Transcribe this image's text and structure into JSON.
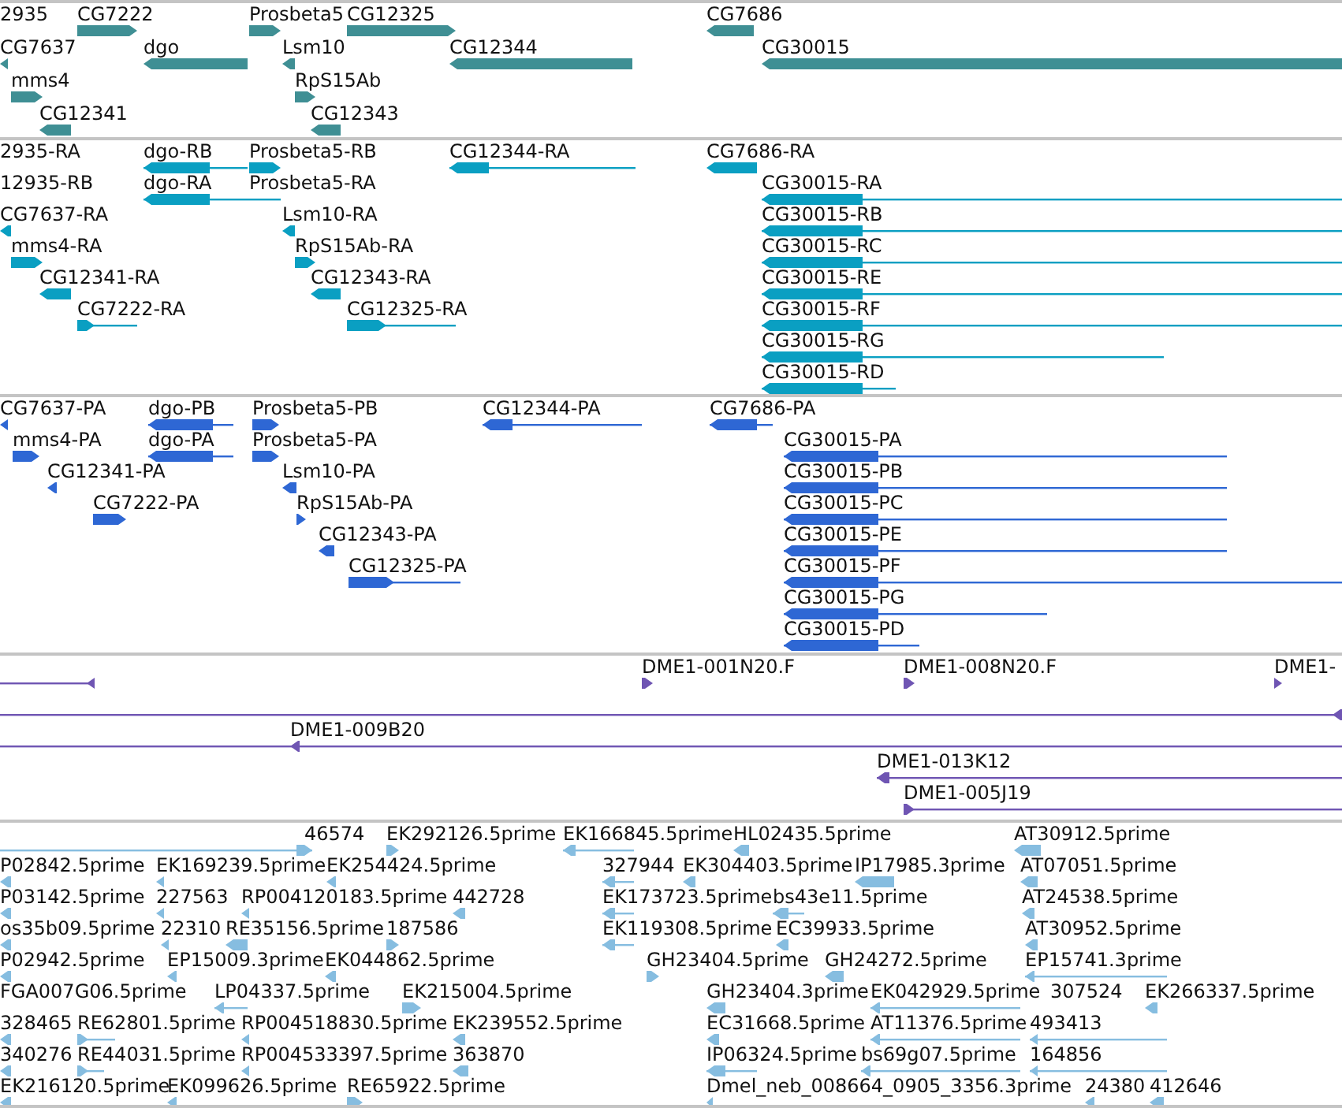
{
  "tracks": [
    {
      "kind": "gene",
      "color": "#3f8f94",
      "features": [
        {
          "label": "2935"
        },
        {
          "label": "CG7222",
          "reverse": false
        },
        {
          "label": "Prosbeta5",
          "reverse": false
        },
        {
          "label": "CG12325",
          "reverse": false
        },
        {
          "label": "CG7686",
          "reverse": true
        },
        {
          "label": "CG7637",
          "reverse": true
        },
        {
          "label": "dgo",
          "reverse": true
        },
        {
          "label": "Lsm10",
          "reverse": true
        },
        {
          "label": "CG12344",
          "reverse": true
        },
        {
          "label": "CG30015",
          "reverse": true
        },
        {
          "label": "mms4",
          "reverse": false
        },
        {
          "label": "RpS15Ab",
          "reverse": false
        },
        {
          "label": "CG12341",
          "reverse": true
        },
        {
          "label": "CG12343",
          "reverse": true
        }
      ]
    },
    {
      "kind": "transcript",
      "color": "#0a9fc2",
      "features": [
        {
          "label": "2935-RA"
        },
        {
          "label": "dgo-RB",
          "reverse": true
        },
        {
          "label": "Prosbeta5-RB",
          "reverse": false
        },
        {
          "label": "CG12344-RA",
          "reverse": true
        },
        {
          "label": "CG7686-RA",
          "reverse": true
        },
        {
          "label": "12935-RB"
        },
        {
          "label": "dgo-RA",
          "reverse": true
        },
        {
          "label": "Prosbeta5-RA"
        },
        {
          "label": "CG30015-RA",
          "reverse": true
        },
        {
          "label": "CG7637-RA",
          "reverse": true
        },
        {
          "label": "Lsm10-RA",
          "reverse": true
        },
        {
          "label": "CG30015-RB",
          "reverse": true
        },
        {
          "label": "mms4-RA",
          "reverse": false
        },
        {
          "label": "RpS15Ab-RA",
          "reverse": false
        },
        {
          "label": "CG30015-RC",
          "reverse": true
        },
        {
          "label": "CG12341-RA",
          "reverse": true
        },
        {
          "label": "CG12343-RA",
          "reverse": true
        },
        {
          "label": "CG30015-RE",
          "reverse": true
        },
        {
          "label": "CG7222-RA",
          "reverse": false
        },
        {
          "label": "CG12325-RA",
          "reverse": false
        },
        {
          "label": "CG30015-RF",
          "reverse": true
        },
        {
          "label": "CG30015-RG",
          "reverse": true
        },
        {
          "label": "CG30015-RD",
          "reverse": true
        }
      ]
    },
    {
      "kind": "protein",
      "color": "#2e67d4",
      "features": [
        {
          "label": "CG7637-PA",
          "reverse": true
        },
        {
          "label": "dgo-PB",
          "reverse": true
        },
        {
          "label": "Prosbeta5-PB",
          "reverse": false
        },
        {
          "label": "CG12344-PA",
          "reverse": true
        },
        {
          "label": "CG7686-PA",
          "reverse": true
        },
        {
          "label": "mms4-PA",
          "reverse": false
        },
        {
          "label": "dgo-PA",
          "reverse": true
        },
        {
          "label": "Prosbeta5-PA",
          "reverse": false
        },
        {
          "label": "CG30015-PA",
          "reverse": true
        },
        {
          "label": "CG12341-PA",
          "reverse": true
        },
        {
          "label": "Lsm10-PA",
          "reverse": true
        },
        {
          "label": "CG30015-PB",
          "reverse": true
        },
        {
          "label": "CG7222-PA",
          "reverse": false
        },
        {
          "label": "RpS15Ab-PA",
          "reverse": false
        },
        {
          "label": "CG30015-PC",
          "reverse": true
        },
        {
          "label": "CG12343-PA",
          "reverse": true
        },
        {
          "label": "CG30015-PE",
          "reverse": true
        },
        {
          "label": "CG12325-PA",
          "reverse": false
        },
        {
          "label": "CG30015-PF",
          "reverse": true
        },
        {
          "label": "CG30015-PG",
          "reverse": true
        },
        {
          "label": "CG30015-PD",
          "reverse": true
        }
      ]
    },
    {
      "kind": "clone",
      "color": "#6f55b3",
      "features": [
        {
          "reverse": true
        },
        {
          "label": "DME1-001N20.F",
          "reverse": false
        },
        {
          "label": "DME1-008N20.F",
          "reverse": false
        },
        {
          "label": "DME1-",
          "reverse": false
        },
        {
          "reverse": true
        },
        {
          "label": "DME1-009B20",
          "reverse": true
        },
        {
          "label": "DME1-013K12",
          "reverse": true
        },
        {
          "label": "DME1-005J19",
          "reverse": false
        }
      ]
    },
    {
      "kind": "est",
      "color": "#86bde0",
      "features": [
        {
          "label": "46574",
          "reverse": false
        },
        {
          "label": "EK292126.5prime",
          "reverse": false
        },
        {
          "label": "EK166845.5prime",
          "reverse": true
        },
        {
          "label": "HL02435.5prime",
          "reverse": true
        },
        {
          "label": "AT30912.5prime",
          "reverse": true
        },
        {
          "label": "P02842.5prime",
          "reverse": true
        },
        {
          "label": "EK169239.5prime",
          "reverse": true
        },
        {
          "label": "EK254424.5prime",
          "reverse": true
        },
        {
          "label": "327944",
          "reverse": true
        },
        {
          "label": "EK304403.5prime",
          "reverse": true
        },
        {
          "label": "IP17985.3prime",
          "reverse": true
        },
        {
          "label": "AT07051.5prime",
          "reverse": true
        },
        {
          "label": "P03142.5prime",
          "reverse": true
        },
        {
          "label": "227563",
          "reverse": true
        },
        {
          "label": "RP004120183.5prime",
          "reverse": true
        },
        {
          "label": "442728",
          "reverse": true
        },
        {
          "label": "EK173723.5prime",
          "reverse": true
        },
        {
          "label": "bs43e11.5prime",
          "reverse": true
        },
        {
          "label": "AT24538.5prime",
          "reverse": true
        },
        {
          "label": "os35b09.5prime",
          "reverse": true
        },
        {
          "label": "22310",
          "reverse": true
        },
        {
          "label": "RE35156.5prime",
          "reverse": true
        },
        {
          "label": "187586",
          "reverse": false
        },
        {
          "label": "EK119308.5prime",
          "reverse": true
        },
        {
          "label": "EC39933.5prime",
          "reverse": true
        },
        {
          "label": "AT30952.5prime",
          "reverse": true
        },
        {
          "label": "P02942.5prime",
          "reverse": true
        },
        {
          "label": "EP15009.3prime",
          "reverse": true
        },
        {
          "label": "EK044862.5prime",
          "reverse": true
        },
        {
          "label": "GH23404.5prime",
          "reverse": false
        },
        {
          "label": "GH24272.5prime",
          "reverse": true
        },
        {
          "label": "EP15741.3prime",
          "reverse": true
        },
        {
          "label": "FGA007G06.5prime"
        },
        {
          "label": "LP04337.5prime",
          "reverse": true
        },
        {
          "label": "EK215004.5prime",
          "reverse": false
        },
        {
          "label": "GH23404.3prime",
          "reverse": true
        },
        {
          "label": "EK042929.5prime",
          "reverse": true
        },
        {
          "label": "307524"
        },
        {
          "label": "EK266337.5prime",
          "reverse": true
        },
        {
          "label": "328465",
          "reverse": true
        },
        {
          "label": "RE62801.5prime",
          "reverse": false
        },
        {
          "label": "RP004518830.5prime",
          "reverse": true
        },
        {
          "label": "EK239552.5prime",
          "reverse": true
        },
        {
          "label": "EC31668.5prime",
          "reverse": true
        },
        {
          "label": "AT11376.5prime",
          "reverse": true
        },
        {
          "label": "493413",
          "reverse": true
        },
        {
          "label": "340276",
          "reverse": true
        },
        {
          "label": "RE44031.5prime",
          "reverse": false
        },
        {
          "label": "RP004533397.5prime",
          "reverse": true
        },
        {
          "label": "363870",
          "reverse": true
        },
        {
          "label": "IP06324.5prime",
          "reverse": true
        },
        {
          "label": "bs69g07.5prime",
          "reverse": true
        },
        {
          "label": "164856",
          "reverse": true
        },
        {
          "label": "EK216120.5prime",
          "reverse": true
        },
        {
          "label": "EK099626.5prime",
          "reverse": true
        },
        {
          "label": "RE65922.5prime",
          "reverse": false
        },
        {
          "label": "Dmel_neb_008664_0905_3356.3prime",
          "reverse": true
        },
        {
          "label": "24380",
          "reverse": true
        },
        {
          "label": "412646",
          "reverse": true
        }
      ]
    }
  ]
}
